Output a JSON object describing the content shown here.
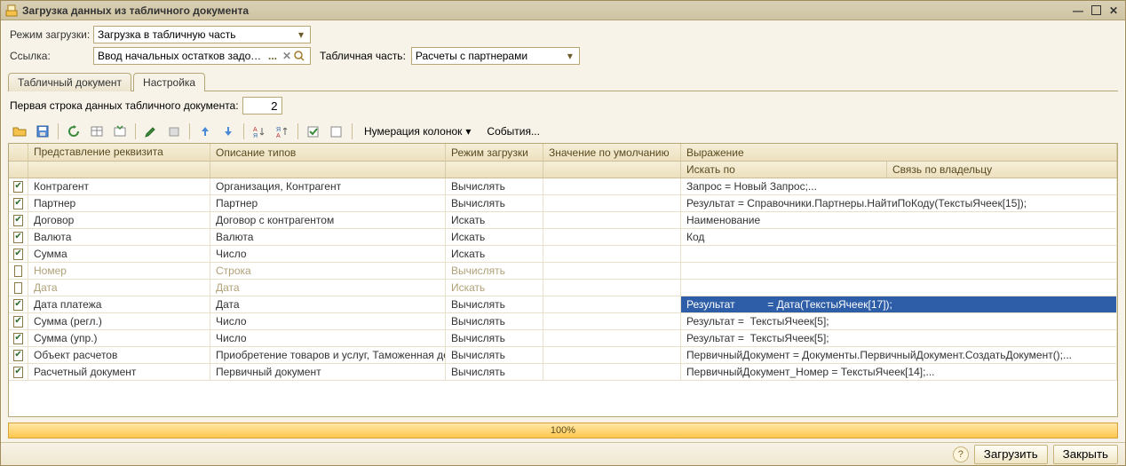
{
  "window": {
    "title": "Загрузка данных из табличного документа"
  },
  "fields": {
    "mode_label": "Режим загрузки:",
    "mode_value": "Загрузка в табличную часть",
    "ref_label": "Ссылка:",
    "ref_value": "Ввод начальных остатков задолженно",
    "ref_ellipsis": "...",
    "tabpart_label": "Табличная часть:",
    "tabpart_value": "Расчеты с партнерами"
  },
  "tabs": {
    "doc": "Табличный документ",
    "settings": "Настройка"
  },
  "firstrow": {
    "label": "Первая строка данных табличного документа:",
    "value": "2"
  },
  "toolbar": {
    "numbering_label": "Нумерация колонок",
    "events_label": "События..."
  },
  "grid": {
    "headers": {
      "rep": "Представление реквизита",
      "typ": "Описание типов",
      "rz": "Режим загрузки",
      "def": "Значение по умолчанию",
      "expr": "Выражение",
      "find": "Искать по",
      "own": "Связь по владельцу"
    },
    "rows": [
      {
        "checked": true,
        "disabled": false,
        "selected": false,
        "rep": "Контрагент",
        "typ": "Организация, Контрагент",
        "rz": "Вычислять",
        "def": "",
        "expr": "Запрос = Новый Запрос;..."
      },
      {
        "checked": true,
        "disabled": false,
        "selected": false,
        "rep": "Партнер",
        "typ": "Партнер",
        "rz": "Вычислять",
        "def": "",
        "expr": "Результат = Справочники.Партнеры.НайтиПоКоду(ТекстыЯчеек[15]);"
      },
      {
        "checked": true,
        "disabled": false,
        "selected": false,
        "rep": "Договор",
        "typ": "Договор с контрагентом",
        "rz": "Искать",
        "def": "",
        "expr": "Наименование"
      },
      {
        "checked": true,
        "disabled": false,
        "selected": false,
        "rep": "Валюта",
        "typ": "Валюта",
        "rz": "Искать",
        "def": "",
        "expr": "Код"
      },
      {
        "checked": true,
        "disabled": false,
        "selected": false,
        "rep": "Сумма",
        "typ": "Число",
        "rz": "Искать",
        "def": "",
        "expr": ""
      },
      {
        "checked": false,
        "disabled": true,
        "selected": false,
        "rep": "Номер",
        "typ": "Строка",
        "rz": "Вычислять",
        "def": "",
        "expr": ""
      },
      {
        "checked": false,
        "disabled": true,
        "selected": false,
        "rep": "Дата",
        "typ": "Дата",
        "rz": "Искать",
        "def": "",
        "expr": ""
      },
      {
        "checked": true,
        "disabled": false,
        "selected": true,
        "rep": "Дата платежа",
        "typ": "Дата",
        "rz": "Вычислять",
        "def": "",
        "expr": "Результат           = Дата(ТекстыЯчеек[17]);"
      },
      {
        "checked": true,
        "disabled": false,
        "selected": false,
        "rep": "Сумма (регл.)",
        "typ": "Число",
        "rz": "Вычислять",
        "def": "",
        "expr": "Результат =  ТекстыЯчеек[5];"
      },
      {
        "checked": true,
        "disabled": false,
        "selected": false,
        "rep": "Сумма (упр.)",
        "typ": "Число",
        "rz": "Вычислять",
        "def": "",
        "expr": "Результат =  ТекстыЯчеек[5];"
      },
      {
        "checked": true,
        "disabled": false,
        "selected": false,
        "rep": "Объект расчетов",
        "typ": "Приобретение товаров и услуг, Таможенная дек...",
        "rz": "Вычислять",
        "def": "",
        "expr": "ПервичныйДокумент = Документы.ПервичныйДокумент.СоздатьДокумент();..."
      },
      {
        "checked": true,
        "disabled": false,
        "selected": false,
        "rep": "Расчетный документ",
        "typ": "Первичный документ",
        "rz": "Вычислять",
        "def": "",
        "expr": "ПервичныйДокумент_Номер = ТекстыЯчеек[14];..."
      }
    ]
  },
  "progress": {
    "text": "100%"
  },
  "bottom": {
    "load": "Загрузить",
    "close": "Закрыть"
  }
}
